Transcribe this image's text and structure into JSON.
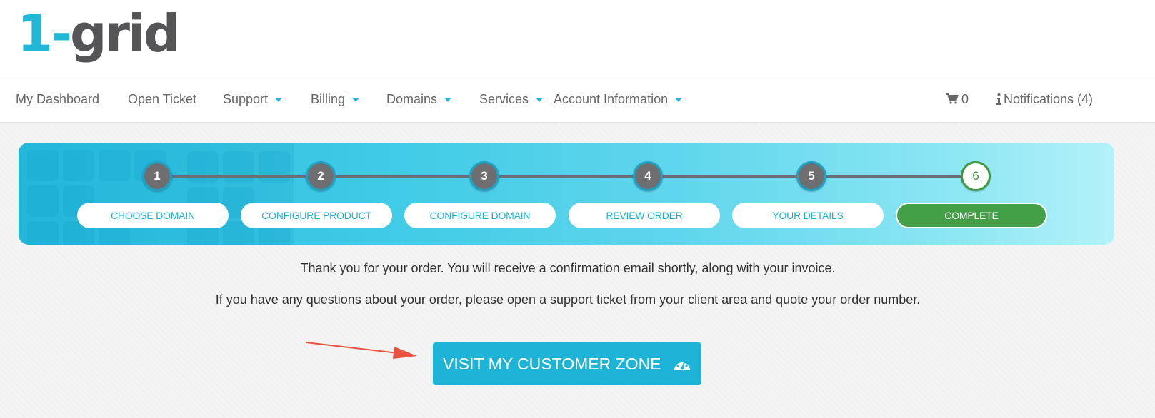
{
  "brand": {
    "logo_part1": "1-",
    "logo_part2": "grid"
  },
  "nav": {
    "dashboard": "My Dashboard",
    "open_ticket": "Open Ticket",
    "support": "Support",
    "billing": "Billing",
    "domains": "Domains",
    "services": "Services",
    "account": "Account Information",
    "cart_count": "0",
    "notifications": "Notifications (4)"
  },
  "steps": [
    {
      "number": "1",
      "label": "CHOOSE DOMAIN"
    },
    {
      "number": "2",
      "label": "CONFIGURE PRODUCT"
    },
    {
      "number": "3",
      "label": "CONFIGURE DOMAIN"
    },
    {
      "number": "4",
      "label": "REVIEW ORDER"
    },
    {
      "number": "5",
      "label": "YOUR DETAILS"
    },
    {
      "number": "6",
      "label": "COMPLETE"
    }
  ],
  "current_step": 6,
  "message": {
    "line1": "Thank you for your order. You will receive a confirmation email shortly, along with your invoice.",
    "line2": "If you have any questions about your order, please open a support ticket from your client area and quote your order number."
  },
  "cta": {
    "label": "VISIT MY CUSTOMER ZONE",
    "icon": "dashboard-gauge-icon"
  },
  "colors": {
    "accent": "#1db4d7",
    "complete_green": "#43a047",
    "annotation_arrow": "#e8523f"
  }
}
